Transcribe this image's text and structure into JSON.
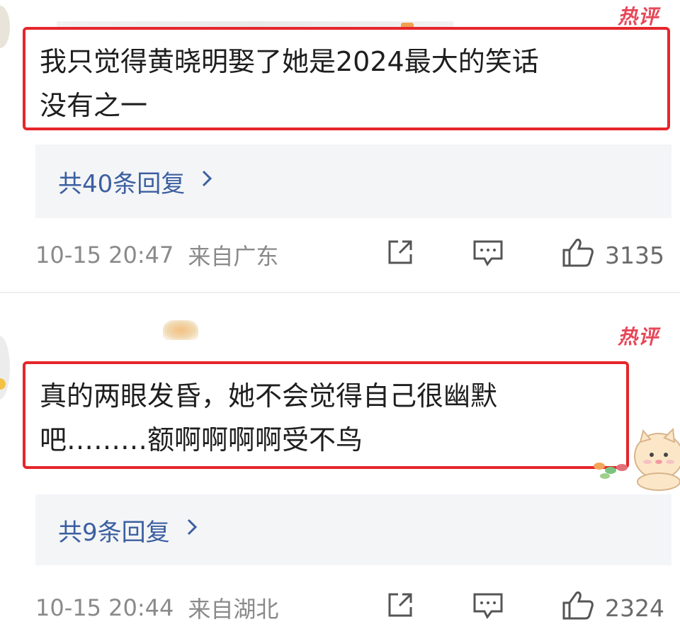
{
  "comments": [
    {
      "hot_label": "热评",
      "text_line1": "我只觉得黄晓明娶了她是2024最大的笑话",
      "text_line2": "没有之一",
      "replies": "共40条回复",
      "time": "10-15 20:47",
      "location": "来自广东",
      "likes": "3135"
    },
    {
      "hot_label": "热评",
      "text_line1": "真的两眼发昏，她不会觉得自己很幽默",
      "text_line2": "吧………额啊啊啊啊受不鸟",
      "replies": "共9条回复",
      "time": "10-15 20:44",
      "location": "来自湖北",
      "likes": "2324"
    }
  ],
  "icons": {
    "share": "share-icon",
    "comment": "comment-icon",
    "like": "thumbs-up-icon",
    "chevron": "chevron-right-icon"
  },
  "colors": {
    "highlight_border": "#e5262b",
    "hot_tag": "#e8475a",
    "reply_link": "#3b5fa0",
    "reply_bg": "#f4f5f7",
    "meta_text": "#8a8a8a"
  }
}
